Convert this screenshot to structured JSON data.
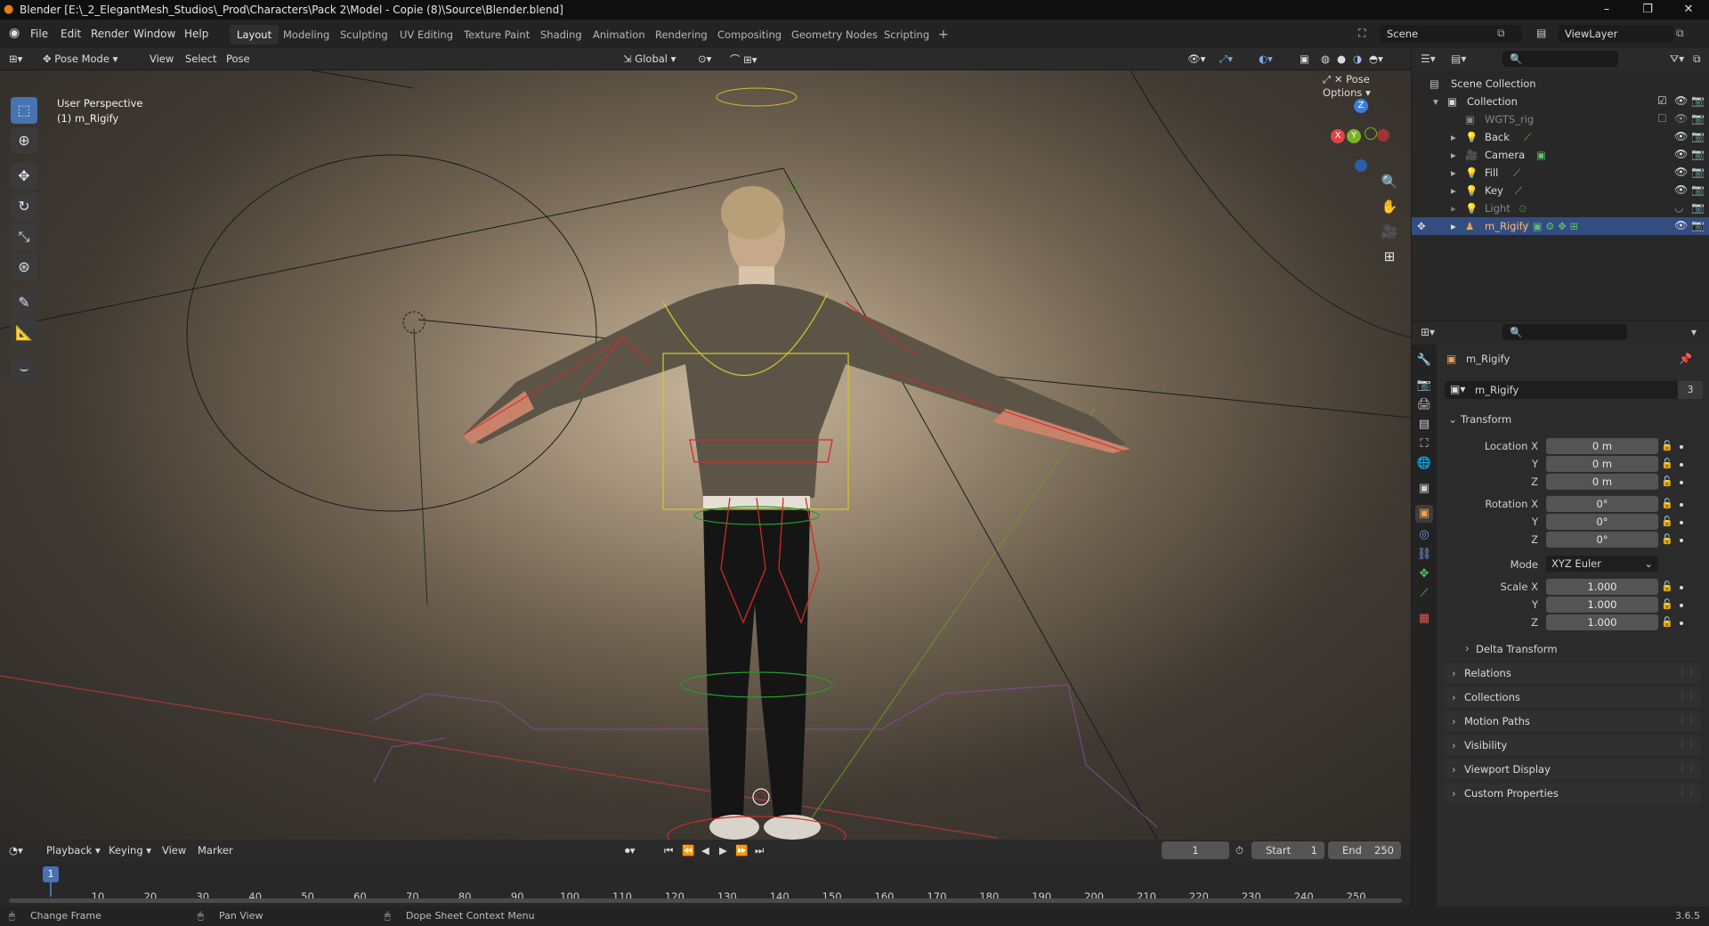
{
  "window": {
    "title": "Blender [E:\\_2_ElegantMesh_Studios\\_Prod\\Characters\\Pack 2\\Model - Copie (8)\\Source\\Blender.blend]"
  },
  "menu": {
    "items": [
      "File",
      "Edit",
      "Render",
      "Window",
      "Help"
    ]
  },
  "workspaces": [
    "Layout",
    "Modeling",
    "Sculpting",
    "UV Editing",
    "Texture Paint",
    "Shading",
    "Animation",
    "Rendering",
    "Compositing",
    "Geometry Nodes",
    "Scripting"
  ],
  "add_tab": "+",
  "scene": {
    "name": "Scene"
  },
  "view_layer": {
    "name": "ViewLayer"
  },
  "viewport_header": {
    "mode": "Pose Mode",
    "view": "View",
    "select": "Select",
    "pose": "Pose",
    "orientation": "Global",
    "pose_options": "Pose Options"
  },
  "viewport": {
    "perspective": "User Perspective",
    "object_label": "(1) m_Rigify"
  },
  "gizmo": {
    "x": "X",
    "y": "Y",
    "z": "Z"
  },
  "outliner": {
    "scene_collection": "Scene Collection",
    "collection": "Collection",
    "items": [
      {
        "label": "WGTS_rig"
      },
      {
        "label": "Back"
      },
      {
        "label": "Camera"
      },
      {
        "label": "Fill"
      },
      {
        "label": "Key"
      },
      {
        "label": "Light"
      },
      {
        "label": "m_Rigify"
      }
    ]
  },
  "properties": {
    "object_name": "m_Rigify",
    "data_name": "m_Rigify",
    "users": "3",
    "transform_title": "Transform",
    "location_label": "Location X",
    "rotation_label": "Rotation X",
    "scale_label": "Scale X",
    "y_label": "Y",
    "z_label": "Z",
    "mode_label": "Mode",
    "location": [
      "0 m",
      "0 m",
      "0 m"
    ],
    "rotation": [
      "0°",
      "0°",
      "0°"
    ],
    "rotation_mode": "XYZ Euler",
    "scale": [
      "1.000",
      "1.000",
      "1.000"
    ],
    "delta_transform": "Delta Transform",
    "panels": [
      "Relations",
      "Collections",
      "Motion Paths",
      "Visibility",
      "Viewport Display",
      "Custom Properties"
    ]
  },
  "timeline": {
    "playback": "Playback",
    "keying": "Keying",
    "view": "View",
    "marker": "Marker",
    "current_frame": "1",
    "start_label": "Start",
    "start": "1",
    "end_label": "End",
    "end": "250",
    "ticks": [
      "1",
      "10",
      "20",
      "30",
      "40",
      "50",
      "60",
      "70",
      "80",
      "90",
      "100",
      "110",
      "120",
      "130",
      "140",
      "150",
      "160",
      "170",
      "180",
      "190",
      "200",
      "210",
      "220",
      "230",
      "240",
      "250"
    ]
  },
  "statusbar": {
    "change_frame": "Change Frame",
    "pan_view": "Pan View",
    "context_menu": "Dope Sheet Context Menu",
    "version": "3.6.5"
  },
  "colors": {
    "accent": "#4772b3",
    "selected_row": "#334d80",
    "axis_x": "#e04343",
    "axis_y": "#7ab32a",
    "axis_z": "#3d7fd9"
  }
}
